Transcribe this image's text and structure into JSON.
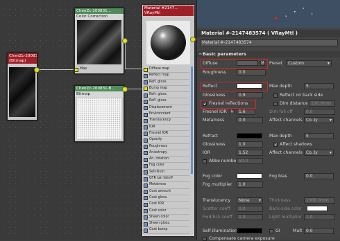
{
  "nodes": {
    "bitmap_left": {
      "title": "ChenZc-200831-B...",
      "subtitle": "(Bitmap)"
    },
    "color_correction": {
      "title": "ChenZc-200831...",
      "subtitle": "Color Correction",
      "slot": "Map"
    },
    "bitmap_bottom": {
      "title": "ChenZc-200831-B...",
      "subtitle": "Bitmap"
    },
    "material": {
      "title": "Material #2147...",
      "subtitle": "VRayMtl",
      "slots": [
        "Diffuse map",
        "Reflect map",
        "Refl. gloss.",
        "Bump map",
        "Refr. gloss.",
        "Refl. gloss.",
        "Displacement",
        "Environment",
        "Translucency",
        "IOR",
        "Fresnel IOR",
        "Opacity",
        "Roughness",
        "Anisotropy",
        "An. rotation",
        "Fog color",
        "Self-illum",
        "GTR tail falloff",
        "Metalness",
        "Coat amount",
        "Coat gloss.",
        "Coat IOR",
        "Coat color",
        "Sheen color",
        "Sheen gloss.",
        "Coat bump"
      ]
    }
  },
  "panel": {
    "header": "Material #-2147483574  ( VRayMtl )",
    "name_field": "Material #-2147483574",
    "section_basic": "Basic parameters",
    "diffuse_label": "Diffuse",
    "diffuse_btn": "M",
    "preset_label": "Preset",
    "preset_value": "Custom",
    "roughness_label": "Roughness",
    "roughness_value": "0.0",
    "reflect_label": "Reflect",
    "max_depth_label": "Max depth",
    "max_depth_value": "5",
    "glossiness_label": "Glossiness",
    "glossiness_value": "0.9",
    "refl_backside_label": "Reflect on back side",
    "fresnel_label": "Fresnel reflections",
    "dim_distance_label": "Dim distance",
    "dim_distance_value": "100.0mm",
    "fresnel_ior_label": "Fresnel IOR",
    "fresnel_ior_l": "L",
    "fresnel_ior_value": "1.6",
    "dim_falloff_label": "Dim fall off",
    "dim_falloff_value": "0.0",
    "metalness_label": "Metalness",
    "metalness_value": "0.0",
    "affect_channels_label": "Affect channels",
    "affect_channels_value": "Co..ly",
    "refract_label": "Refract",
    "refr_max_depth_label": "Max depth",
    "refr_max_depth_value": "5",
    "refr_gloss_label": "Glossiness",
    "refr_gloss_value": "1.0",
    "affect_shadows_label": "Affect shadows",
    "ior_label": "IOR",
    "ior_value": "1.52",
    "refr_affect_label": "Affect channels",
    "refr_affect_value": "Co..ly",
    "abbe_label": "Abbe number",
    "abbe_value": "50.0",
    "fog_color_label": "Fog color",
    "fog_bias_label": "Fog bias",
    "fog_bias_value": "0.0",
    "fog_mult_label": "Fog multiplier",
    "fog_mult_value": "1.0",
    "translucency_label": "Translucency",
    "translucency_value": "None",
    "thickness_label": "Thickness",
    "thickness_value": "1000.0mm",
    "scatter_label": "Scatter coeff",
    "scatter_value": "0.0",
    "backside_label": "Back-side color",
    "fwdbck_label": "Fwd/bck coeff",
    "fwdbck_value": "1.0",
    "light_mult_label": "Light multiplier",
    "light_mult_value": "1.0",
    "selfillum_label": "Self-illumination",
    "gi_label": "GI",
    "mult_label": "Mult",
    "mult_value": "0.0",
    "comp_label": "Compensate camera exposure"
  }
}
